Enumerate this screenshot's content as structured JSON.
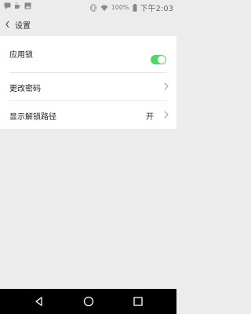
{
  "status_bar": {
    "battery_percent": "100%",
    "time": "下午2:03",
    "icons": [
      "message-icon",
      "cup-icon",
      "image-icon",
      "vibrate-icon",
      "wifi-icon",
      "battery-icon"
    ]
  },
  "toolbar": {
    "back_icon": "chevron-left-icon",
    "title": "设置"
  },
  "settings": {
    "app_lock": {
      "label": "应用锁",
      "enabled": true,
      "accent": "#4cd964"
    },
    "change_password": {
      "label": "更改密码"
    },
    "show_unlock_path": {
      "label": "显示解锁路径",
      "value": "开"
    }
  },
  "nav_bar": {
    "buttons": [
      "back-triangle-icon",
      "home-circle-icon",
      "recents-square-icon"
    ]
  }
}
